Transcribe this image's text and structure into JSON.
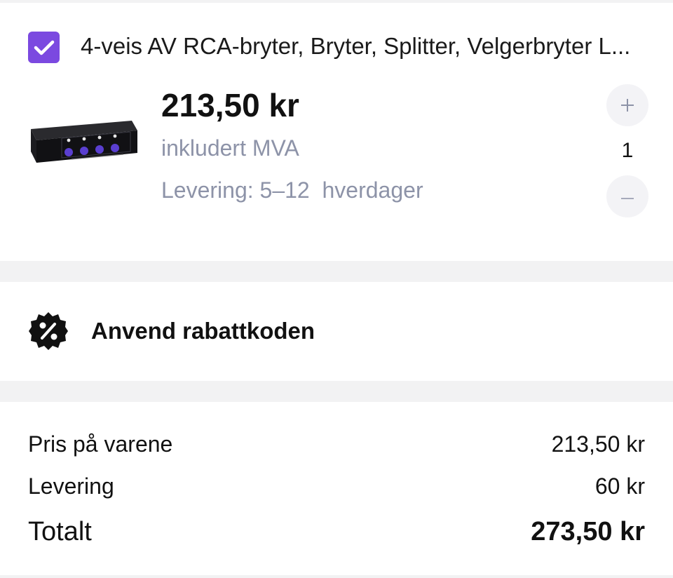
{
  "product": {
    "checked": true,
    "title": "4-veis AV RCA-bryter, Bryter, Splitter, Velgerbryter L...",
    "image_alt": "Black 4-way AV RCA switch box with purple knobs",
    "price": "213,50 kr",
    "vat_note": "inkludert MVA",
    "delivery_note": "Levering: 5–12  hverdager",
    "quantity": "1",
    "plus_symbol": "+",
    "minus_symbol": "–"
  },
  "coupon": {
    "icon": "discount-badge-icon",
    "label": "Anvend rabattkoden"
  },
  "summary": {
    "items_label": "Pris på varene",
    "items_value": "213,50 kr",
    "delivery_label": "Levering",
    "delivery_value": "60 kr",
    "total_label": "Totalt",
    "total_value": "273,50 kr"
  },
  "colors": {
    "accent": "#7b49e0",
    "muted_text": "#8d93a8",
    "separator": "#f2f2f3",
    "qty_button_bg": "#f3f3f6"
  }
}
